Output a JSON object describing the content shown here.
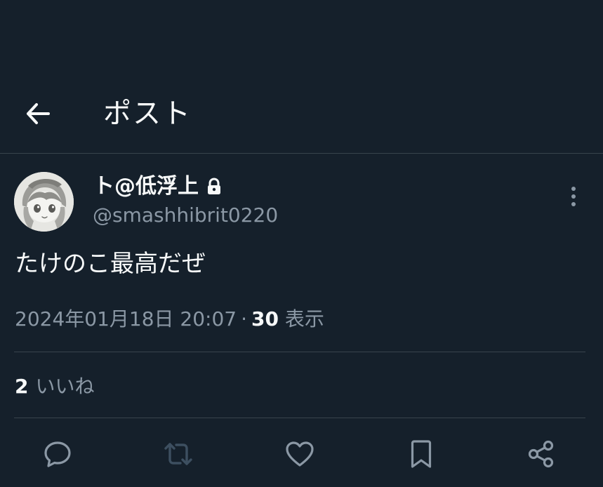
{
  "header": {
    "title": "ポスト",
    "back_icon": "arrow-left-icon"
  },
  "tweet": {
    "author": {
      "display_name": "ト@低浮上",
      "handle": "@smashhibrit0220",
      "protected_icon": "lock-icon",
      "avatar": "anime-character-avatar"
    },
    "text": "たけのこ最高だぜ",
    "timestamp": "2024年01月18日 20:07",
    "separator": "·",
    "views": {
      "count": "30",
      "label": "表示"
    },
    "likes": {
      "count": "2",
      "label": "いいね"
    },
    "more_icon": "more-vertical-icon"
  },
  "actions": [
    {
      "name": "reply",
      "icon": "reply-icon"
    },
    {
      "name": "repost",
      "icon": "repost-icon",
      "disabled": true
    },
    {
      "name": "like",
      "icon": "heart-icon"
    },
    {
      "name": "bookmark",
      "icon": "bookmark-icon"
    },
    {
      "name": "share",
      "icon": "share-icon"
    }
  ],
  "colors": {
    "background": "#15202b",
    "text_primary": "#f7f9f9",
    "text_secondary": "#8b98a5",
    "divider": "#38444d",
    "action_icon": "#8b98a5",
    "action_icon_disabled": "#3d4f60"
  }
}
